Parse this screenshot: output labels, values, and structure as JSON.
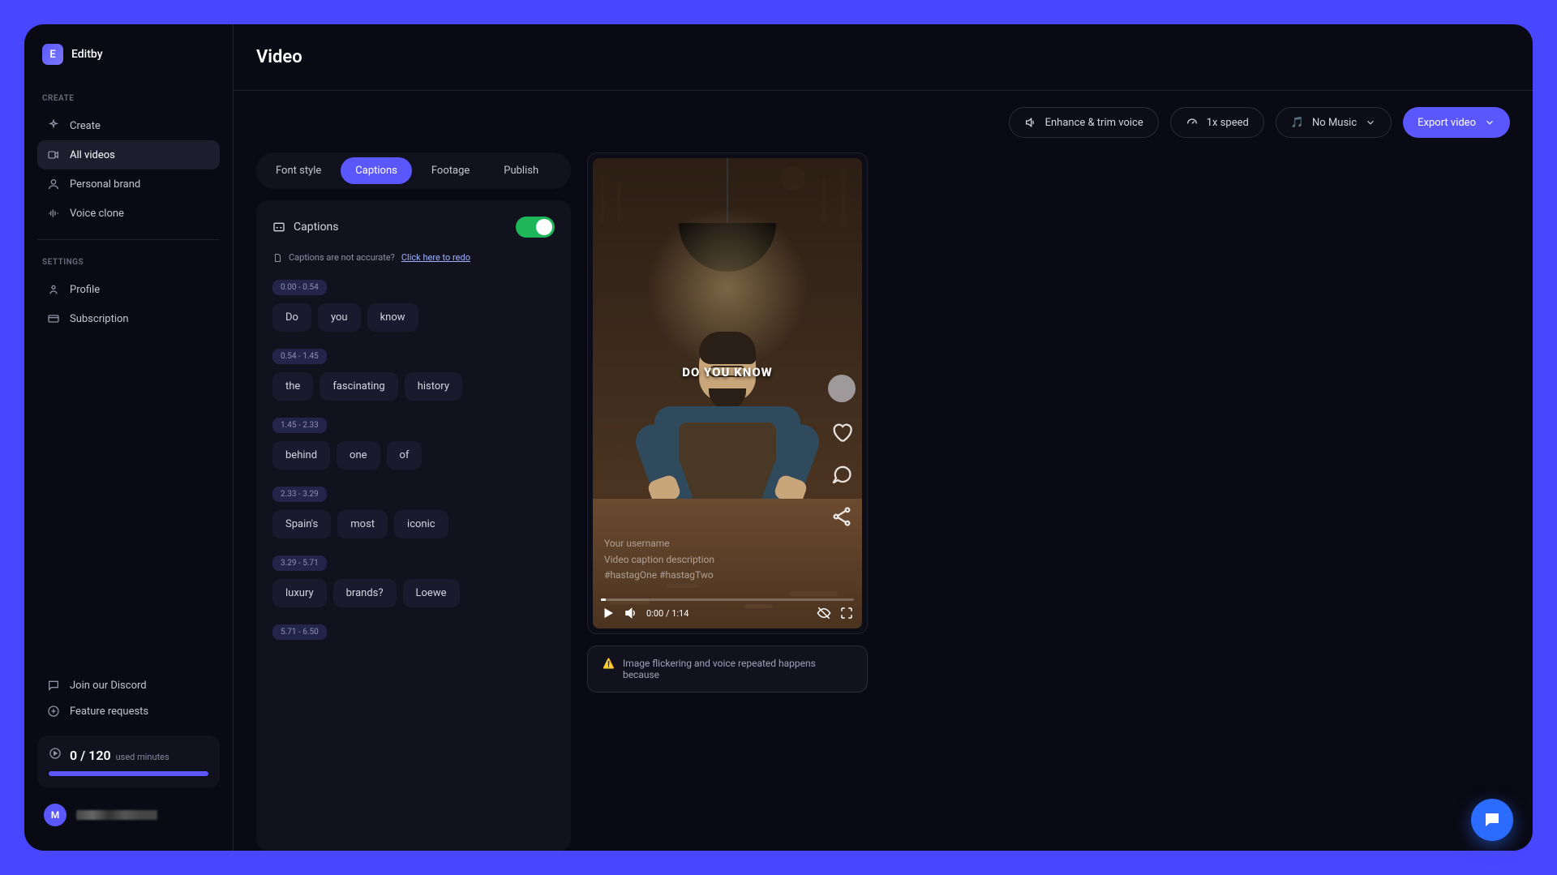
{
  "brand": {
    "initial": "E",
    "name": "Editby"
  },
  "sidebar": {
    "sections": {
      "create_label": "CREATE",
      "settings_label": "SETTINGS"
    },
    "create_items": [
      {
        "label": "Create"
      },
      {
        "label": "All videos"
      },
      {
        "label": "Personal brand"
      },
      {
        "label": "Voice clone"
      }
    ],
    "settings_items": [
      {
        "label": "Profile"
      },
      {
        "label": "Subscription"
      }
    ],
    "bottom": {
      "discord": "Join our Discord",
      "feature": "Feature requests"
    },
    "usage": {
      "used": "0 / 120",
      "suffix": "used minutes"
    },
    "avatar_initial": "M"
  },
  "page": {
    "title": "Video"
  },
  "toolbar": {
    "enhance": "Enhance & trim voice",
    "speed": "1x speed",
    "music": "No Music",
    "export": "Export video"
  },
  "tabs": {
    "font": "Font style",
    "captions": "Captions",
    "footage": "Footage",
    "publish": "Publish"
  },
  "panel": {
    "title": "Captions",
    "redo_prompt": "Captions are not accurate?",
    "redo_link": "Click here to redo"
  },
  "captions": [
    {
      "time": "0.00 - 0.54",
      "words": [
        "Do",
        "you",
        "know"
      ]
    },
    {
      "time": "0.54 - 1.45",
      "words": [
        "the",
        "fascinating",
        "history"
      ]
    },
    {
      "time": "1.45 - 2.33",
      "words": [
        "behind",
        "one",
        "of"
      ]
    },
    {
      "time": "2.33 - 3.29",
      "words": [
        "Spain's",
        "most",
        "iconic"
      ]
    },
    {
      "time": "3.29 - 5.71",
      "words": [
        "luxury",
        "brands?",
        "Loewe"
      ]
    },
    {
      "time": "5.71 - 6.50",
      "words": []
    }
  ],
  "preview": {
    "caption_overlay": "DO YOU KNOW",
    "username": "Your username",
    "description": "Video caption description",
    "hashtags": "#hastagOne #hastagTwo",
    "time": "0:00 / 1:14"
  },
  "warning": {
    "icon": "⚠️",
    "text": "Image flickering and voice repeated happens because"
  }
}
